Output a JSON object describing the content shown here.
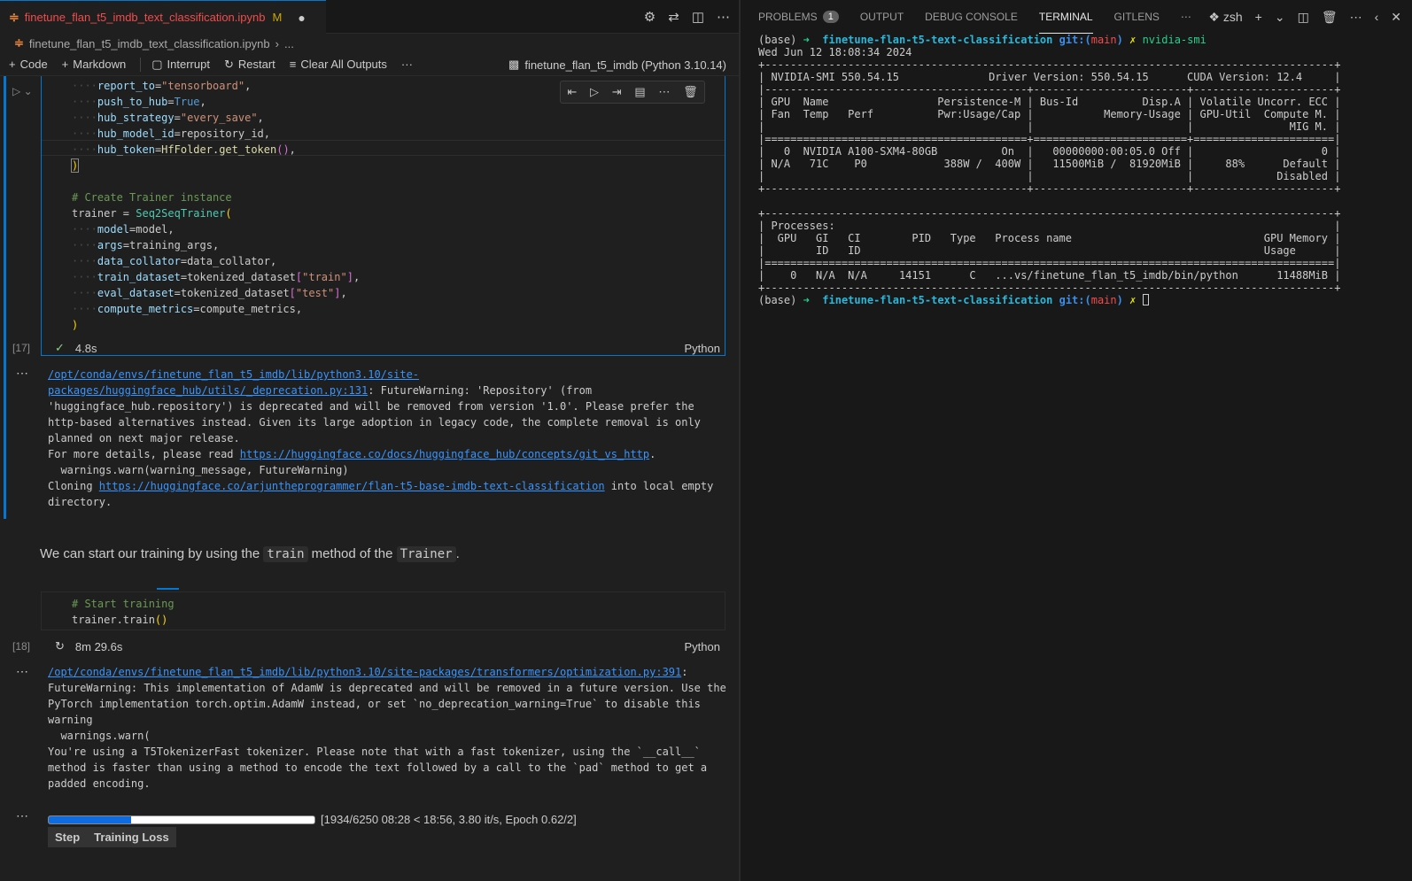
{
  "editor": {
    "tab_title": "finetune_flan_t5_imdb_text_classification.ipynb",
    "tab_status": "M",
    "breadcrumb": [
      "finetune_flan_t5_imdb_text_classification.ipynb",
      "..."
    ],
    "toolbar": {
      "code": "Code",
      "markdown": "Markdown",
      "interrupt": "Interrupt",
      "restart": "Restart",
      "clear_outputs": "Clear All Outputs",
      "more": "···",
      "kernel": "finetune_flan_t5_imdb (Python 3.10.14)"
    }
  },
  "cell17": {
    "exec_count": "[17]",
    "duration": "4.8s",
    "language": "Python",
    "lines": {
      "l1_key": "report_to",
      "l1_val": "\"tensorboard\"",
      "l2_key": "push_to_hub",
      "l2_val": "True",
      "l3_key": "hub_strategy",
      "l3_val": "\"every_save\"",
      "l4_key": "hub_model_id",
      "l4_val": "repository_id",
      "l5_key": "hub_token",
      "l5_val": "HfFolder.get_token",
      "comment": "# Create Trainer instance",
      "trainer_lhs": "trainer = ",
      "trainer_cls": "Seq2SeqTrainer",
      "a1_key": "model",
      "a1_val": "model",
      "a2_key": "args",
      "a2_val": "training_args",
      "a3_key": "data_collator",
      "a3_val": "data_collator",
      "a4_key": "train_dataset",
      "a4_val": "tokenized_dataset",
      "a4_idx": "\"train\"",
      "a5_key": "eval_dataset",
      "a5_val": "tokenized_dataset",
      "a5_idx": "\"test\"",
      "a6_key": "compute_metrics",
      "a6_val": "compute_metrics"
    },
    "output": {
      "link1": "/opt/conda/envs/finetune_flan_t5_imdb/lib/python3.10/site-packages/huggingface_hub/utils/_deprecation.py:131",
      "text1": ": FutureWarning: 'Repository' (from 'huggingface_hub.repository') is deprecated and will be removed from version '1.0'. Please prefer the http-based alternatives instead. Given its large adoption in legacy code, the complete removal is only planned on next major release.",
      "text2": "For more details, please read ",
      "link2": "https://huggingface.co/docs/huggingface_hub/concepts/git_vs_http",
      "text3": ".",
      "text4": "  warnings.warn(warning_message, FutureWarning)",
      "text5": "Cloning ",
      "link3": "https://huggingface.co/arjuntheprogrammer/flan-t5-base-imdb-text-classification",
      "text6": " into local empty directory."
    }
  },
  "markdown": {
    "before": "We can start our training by using the ",
    "code1": "train",
    "middle": " method of the ",
    "code2": "Trainer",
    "after": "."
  },
  "cell18": {
    "exec_count": "[18]",
    "comment": "# Start training",
    "call": "trainer.train",
    "duration": "8m 29.6s",
    "language": "Python",
    "output": {
      "link1": "/opt/conda/envs/finetune_flan_t5_imdb/lib/python3.10/site-packages/transformers/optimization.py:391",
      "text1": ":\nFutureWarning: This implementation of AdamW is deprecated and will be removed in a future version. Use the PyTorch implementation torch.optim.AdamW instead, or set `no_deprecation_warning=True` to disable this warning\n  warnings.warn(\nYou're using a T5TokenizerFast tokenizer. Please note that with a fast tokenizer, using the `__call__` method is faster than using a method to encode the text followed by a call to the `pad` method to get a padded encoding."
    },
    "progress": {
      "fraction": 0.3094,
      "label": "[1934/6250 08:28 < 18:56, 3.80 it/s, Epoch 0.62/2]"
    },
    "table_headers": [
      "Step",
      "Training Loss"
    ]
  },
  "panel": {
    "tabs": [
      {
        "label": "PROBLEMS",
        "badge": "1"
      },
      {
        "label": "OUTPUT"
      },
      {
        "label": "DEBUG CONSOLE"
      },
      {
        "label": "TERMINAL"
      },
      {
        "label": "GITLENS"
      }
    ],
    "shell": "zsh"
  },
  "terminal": {
    "prompt_env": "(base)",
    "prompt_arrow": "➜",
    "prompt_dir": "finetune-flan-t5-text-classification",
    "prompt_git": "git:(",
    "prompt_branch": "main",
    "prompt_git_close": ")",
    "prompt_dirty": "✗",
    "command": "nvidia-smi",
    "date_line": "Wed Jun 12 18:08:34 2024",
    "smi_output": "+-----------------------------------------------------------------------------------------+\n| NVIDIA-SMI 550.54.15              Driver Version: 550.54.15      CUDA Version: 12.4     |\n|-----------------------------------------+------------------------+----------------------+\n| GPU  Name                 Persistence-M | Bus-Id          Disp.A | Volatile Uncorr. ECC |\n| Fan  Temp   Perf          Pwr:Usage/Cap |           Memory-Usage | GPU-Util  Compute M. |\n|                                         |                        |               MIG M. |\n|=========================================+========================+======================|\n|   0  NVIDIA A100-SXM4-80GB          On  |   00000000:00:05.0 Off |                    0 |\n| N/A   71C    P0            388W /  400W |   11500MiB /  81920MiB |     88%      Default |\n|                                         |                        |             Disabled |\n+-----------------------------------------+------------------------+----------------------+\n\n+-----------------------------------------------------------------------------------------+\n| Processes:                                                                              |\n|  GPU   GI   CI        PID   Type   Process name                              GPU Memory |\n|        ID   ID                                                               Usage      |\n|=========================================================================================|\n|    0   N/A  N/A     14151      C   ...vs/finetune_flan_t5_imdb/bin/python      11488MiB |\n+-----------------------------------------------------------------------------------------+"
  },
  "colors": {
    "accent": "#0078d4",
    "progress": "#0e6be0"
  }
}
